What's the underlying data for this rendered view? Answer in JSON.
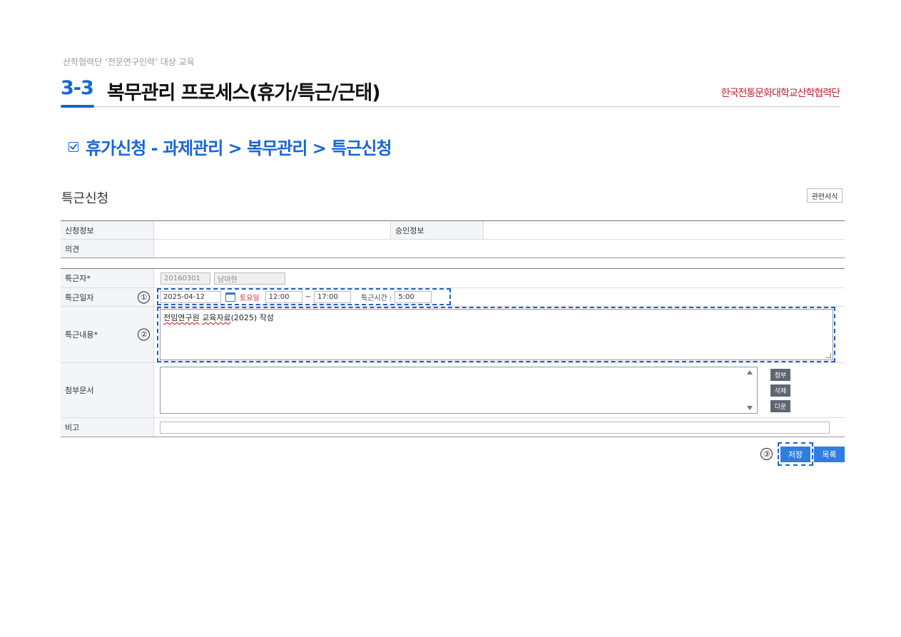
{
  "slide": {
    "subtitle": "산학협력단 ‘전문연구인력’ 대상 교육",
    "section_number": "3-3",
    "section_title": "복무관리 프로세스(휴가/특근/근태)",
    "logo_text": "한국전통문화대학교산학협력단",
    "bullet_title": "휴가신청 - 과제관리 > 복무관리 > 특근신청",
    "colors": {
      "accent": "#1566d6",
      "logo": "#b7232f",
      "highlight": "#1e5fd0"
    }
  },
  "form": {
    "title": "특근신청",
    "related_forms_button": "관련서식",
    "info_table": {
      "application_info_label": "신청정보",
      "approval_info_label": "승인정보",
      "opinion_label": "의견"
    },
    "worker_label": "특근자",
    "worker_id": "20160301",
    "worker_name": "남아현",
    "date_label": "특근일자",
    "date_marker": "①",
    "date_value": "2025-04-12",
    "day_of_week": "토요일",
    "start_time": "12:00",
    "tilde": "~",
    "end_time": "17:00",
    "overtime_hours_label": "특근시간 :",
    "overtime_hours_value": "5:00",
    "content_label": "특근내용",
    "content_marker": "②",
    "content_parts": [
      "전임연구원",
      "교육자료",
      "(2025) 작성"
    ],
    "attachment_label": "첨부문서",
    "attach_button": "첨부",
    "delete_button": "삭제",
    "download_button": "다운",
    "remarks_label": "비고",
    "required_mark": "*",
    "save_marker": "③",
    "save_button": "저장",
    "list_button": "목록"
  }
}
